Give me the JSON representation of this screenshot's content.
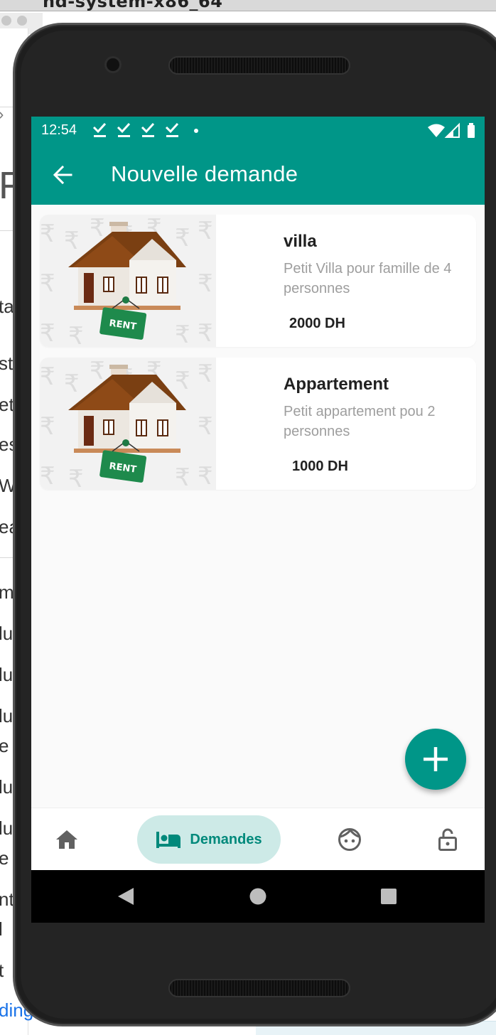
{
  "host": {
    "title_fragment": "nd-system-x86_64",
    "side_fragments": [
      "ta",
      "st",
      "et",
      "es",
      "Wr",
      "ea",
      "m",
      "lu",
      "lu",
      "lu",
      "e",
      "lu",
      "lu",
      "e",
      "nt",
      "l",
      "t"
    ],
    "big_fragment": "F",
    "link_fragment": "ding"
  },
  "status_bar": {
    "time": "12:54",
    "notification_icons": [
      "check-download-icon",
      "check-download-icon",
      "check-download-icon",
      "check-download-icon"
    ],
    "right_icons": [
      "wifi-icon",
      "signal-icon",
      "battery-icon"
    ],
    "color": "#009688"
  },
  "app_bar": {
    "title": "Nouvelle demande",
    "back_icon": "arrow-left-icon",
    "color": "#009688"
  },
  "listings": [
    {
      "title": "villa",
      "description": "Petit Villa pour famille de 4 personnes",
      "price": "2000 DH",
      "image_sign": "RENT"
    },
    {
      "title": "Appartement",
      "description": "Petit appartement pou 2 personnes",
      "price": "1000 DH",
      "image_sign": "RENT"
    }
  ],
  "fab": {
    "icon": "plus-icon",
    "color": "#009688"
  },
  "bottom_nav": {
    "items": [
      {
        "icon": "home-icon",
        "label": "",
        "active": false
      },
      {
        "icon": "bed-icon",
        "label": "Demandes",
        "active": true
      },
      {
        "icon": "face-icon",
        "label": "",
        "active": false
      },
      {
        "icon": "lock-open-icon",
        "label": "",
        "active": false
      }
    ],
    "active_color": "#00897b",
    "active_bg": "#cdeae7"
  },
  "system_nav": {
    "icons": [
      "back-triangle-icon",
      "home-circle-icon",
      "recents-square-icon"
    ]
  }
}
